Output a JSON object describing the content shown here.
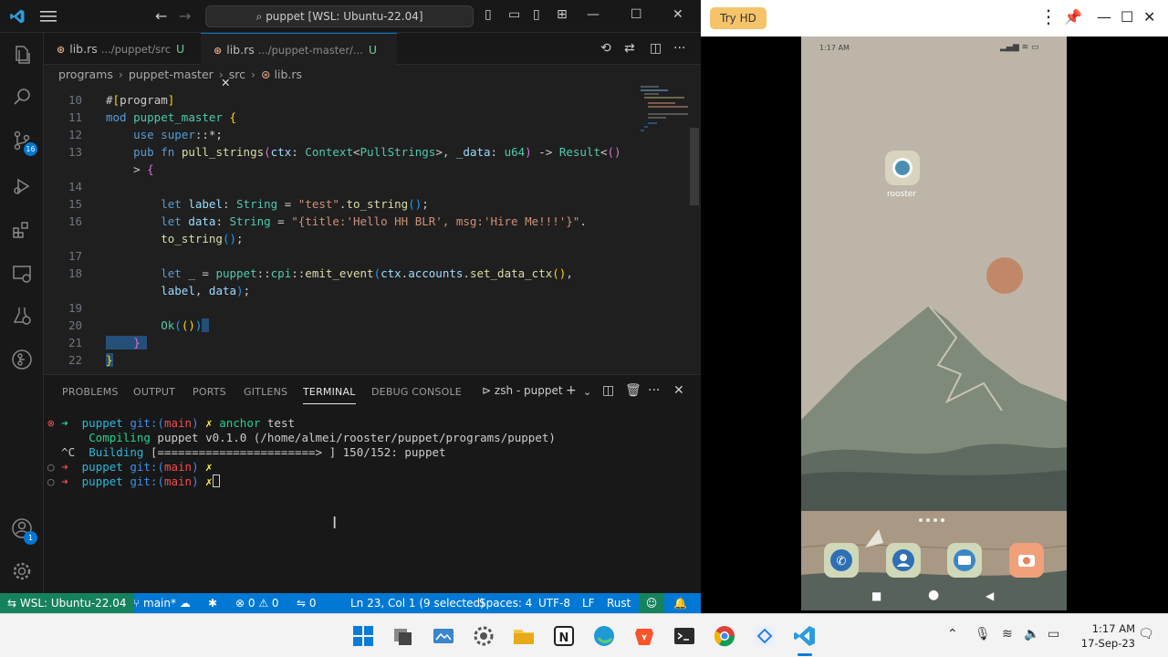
{
  "vscode": {
    "search_title": "puppet [WSL: Ubuntu-22.04]",
    "tabs": [
      {
        "name": "lib.rs",
        "desc": ".../puppet/src",
        "status": "U"
      },
      {
        "name": "lib.rs",
        "desc": ".../puppet-master/...",
        "status": "U"
      }
    ],
    "scm_badge": "16",
    "accounts_badge": "1",
    "breadcrumb": [
      "programs",
      "puppet-master",
      "src",
      "lib.rs"
    ],
    "line_numbers": [
      "10",
      "11",
      "12",
      "13",
      "",
      "14",
      "15",
      "16",
      "",
      "17",
      "18",
      "",
      "19",
      "20",
      "21",
      "22"
    ],
    "panel_tabs": [
      "PROBLEMS",
      "OUTPUT",
      "PORTS",
      "GITLENS",
      "TERMINAL",
      "DEBUG CONSOLE"
    ],
    "terminal_name": "zsh - puppet",
    "terminal": {
      "l1_dir": "puppet",
      "l1_git": "git:(",
      "l1_branch": "main",
      "l1_close": ")",
      "l1_x": "✗",
      "l1_cmd": "anchor",
      "l1_args": "test",
      "l2_label": "Compiling",
      "l2_text": "puppet v0.1.0 (/home/almei/rooster/puppet/programs/puppet)",
      "l3_ctrl": "^C",
      "l3_label": "Building",
      "l3_text": "[=======================> ] 150/152: puppet"
    },
    "statusbar": {
      "remote": "WSL: Ubuntu-22.04",
      "branch": "main*",
      "problems": "0",
      "warnings": "0",
      "ports": "0",
      "position": "Ln 23, Col 1 (9 selected)",
      "spaces": "Spaces: 4",
      "encoding": "UTF-8",
      "eol": "LF",
      "language": "Rust"
    }
  },
  "mirror": {
    "try_hd": "Try HD",
    "phone_time": "1:17 AM",
    "app_label": "rooster"
  },
  "taskbar": {
    "time": "1:17 AM",
    "date": "17-Sep-23"
  },
  "colors": {
    "status_blue": "#0078d4",
    "remote_green": "#16825d",
    "editor_bg": "#1f1f1f",
    "try_hd_bg": "#f5c46a"
  }
}
